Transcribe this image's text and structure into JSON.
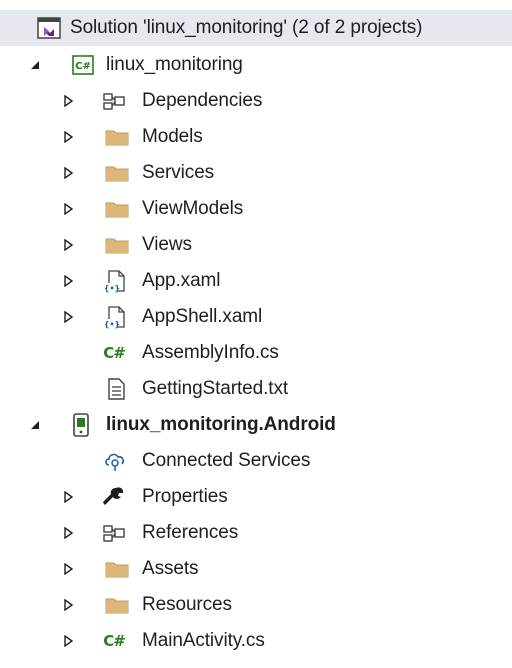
{
  "solution": {
    "label": "Solution 'linux_monitoring' (2 of 2 projects)",
    "icon": "solution-icon"
  },
  "project1": {
    "label": "linux_monitoring",
    "icon": "csharp-project-icon",
    "items": [
      {
        "label": "Dependencies",
        "icon": "dependencies-icon"
      },
      {
        "label": "Models",
        "icon": "folder-icon"
      },
      {
        "label": "Services",
        "icon": "folder-icon"
      },
      {
        "label": "ViewModels",
        "icon": "folder-icon"
      },
      {
        "label": "Views",
        "icon": "folder-icon"
      },
      {
        "label": "App.xaml",
        "icon": "xaml-file-icon"
      },
      {
        "label": "AppShell.xaml",
        "icon": "xaml-file-icon"
      },
      {
        "label": "AssemblyInfo.cs",
        "icon": "csharp-file-icon",
        "glyph": "C#"
      },
      {
        "label": "GettingStarted.txt",
        "icon": "text-file-icon"
      }
    ]
  },
  "project2": {
    "label": "linux_monitoring.Android",
    "icon": "android-project-icon",
    "items": [
      {
        "label": "Connected Services",
        "icon": "connected-services-icon"
      },
      {
        "label": "Properties",
        "icon": "wrench-icon"
      },
      {
        "label": "References",
        "icon": "references-icon"
      },
      {
        "label": "Assets",
        "icon": "folder-icon"
      },
      {
        "label": "Resources",
        "icon": "folder-icon"
      },
      {
        "label": "MainActivity.cs",
        "icon": "csharp-file-icon",
        "glyph": "C#"
      }
    ]
  },
  "colors": {
    "selection": "#e5e8ef",
    "folder": "#dcb67a",
    "csharp": "#2a7d1e",
    "accent": "#68217a"
  }
}
